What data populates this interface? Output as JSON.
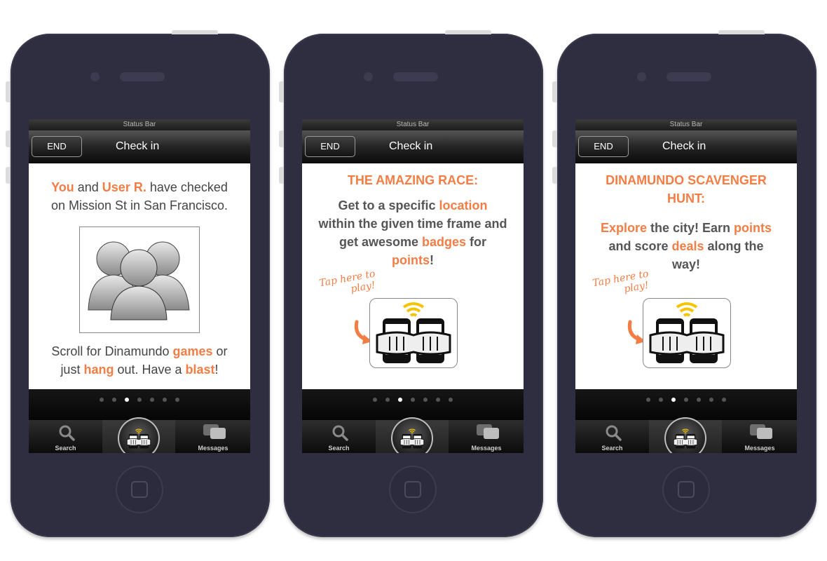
{
  "screens": [
    {
      "status_bar": "Status Bar",
      "end_button": "END",
      "title": "Check in",
      "line1": {
        "a": "You",
        "b": " and ",
        "c": "User R.",
        "d": " have checked"
      },
      "line2": "on Mission St in San Francisco.",
      "line3": {
        "a": "Scroll for Dinamundo ",
        "b": "games",
        "c": " or"
      },
      "line4": {
        "a": "just ",
        "b": "hang",
        "c": " out. Have a ",
        "d": "blast",
        "e": "!"
      }
    },
    {
      "status_bar": "Status Bar",
      "end_button": "END",
      "title": "Check in",
      "heading": "THE AMAZING RACE:",
      "line1": {
        "a": "Get to a specific ",
        "b": "location"
      },
      "line2": "within the given time frame and",
      "line3": {
        "a": "get awesome ",
        "b": "badges",
        "c": " for"
      },
      "line4": {
        "a": "points",
        "b": "!"
      },
      "tap_hint": {
        "a": "Tap here to",
        "b": "play!"
      }
    },
    {
      "status_bar": "Status Bar",
      "end_button": "END",
      "title": "Check in",
      "heading1": "DINAMUNDO SCAVENGER",
      "heading2": "HUNT:",
      "line1": {
        "a": "Explore",
        "b": " the city! Earn ",
        "c": "points"
      },
      "line2": {
        "a": "and score ",
        "b": "deals",
        "c": " along the"
      },
      "line3": "way!",
      "tap_hint": {
        "a": "Tap here to",
        "b": "play!"
      }
    }
  ],
  "tabbar": {
    "search": "Search",
    "messages": "Messages"
  },
  "colors": {
    "accent": "#f47d45",
    "frame": "#2f2e40",
    "text": "#555555"
  },
  "icons": [
    "users-group-icon",
    "search-icon",
    "messages-icon",
    "play-phones-icon",
    "camera-icon",
    "speaker-icon",
    "home-button-icon"
  ]
}
